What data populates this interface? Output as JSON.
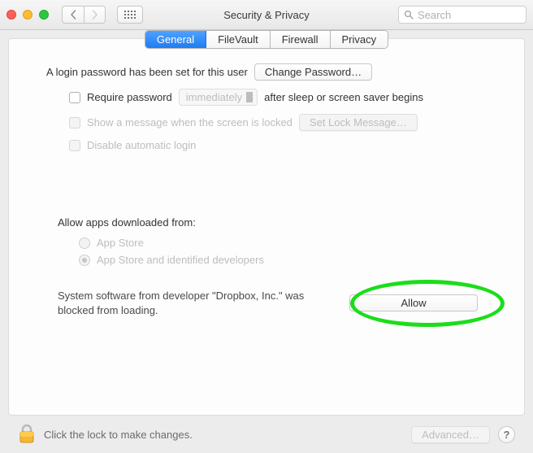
{
  "window": {
    "title": "Security & Privacy"
  },
  "toolbar": {
    "search_placeholder": "Search"
  },
  "tabs": {
    "general": "General",
    "filevault": "FileVault",
    "firewall": "Firewall",
    "privacy": "Privacy",
    "selected": "general"
  },
  "password_section": {
    "set_text": "A login password has been set for this user",
    "change_button": "Change Password…",
    "require_label": "Require password",
    "require_delay": "immediately",
    "require_suffix": "after sleep or screen saver begins",
    "show_message_label": "Show a message when the screen is locked",
    "set_lock_message_button": "Set Lock Message…",
    "disable_auto_login_label": "Disable automatic login"
  },
  "download_section": {
    "heading": "Allow apps downloaded from:",
    "option_app_store": "App Store",
    "option_identified": "App Store and identified developers",
    "selected": "identified"
  },
  "blocked_section": {
    "message": "System software from developer \"Dropbox, Inc.\" was blocked from loading.",
    "allow_button": "Allow"
  },
  "footer": {
    "lock_text": "Click the lock to make changes.",
    "advanced_button": "Advanced…"
  }
}
